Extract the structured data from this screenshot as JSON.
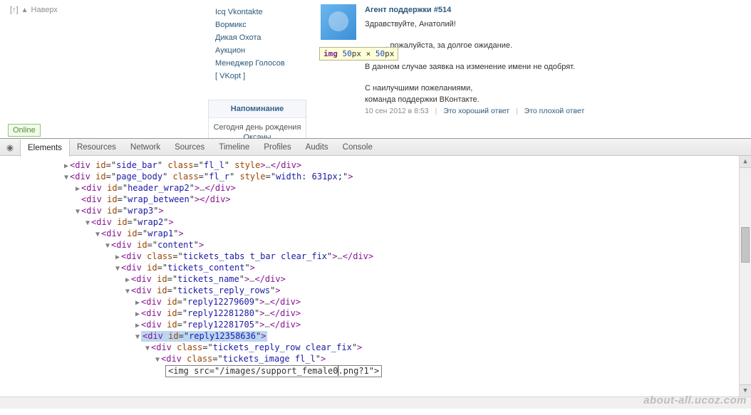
{
  "back_to_top": {
    "symbol": "[↑]",
    "label": "Наверх"
  },
  "sidebar": {
    "links": [
      "Icq Vkontakte",
      "Вормикс",
      "Дикая Охота",
      "Аукцион",
      "Менеджер Голосов"
    ],
    "vkopt": "[ VKopt ]"
  },
  "reminder": {
    "title": "Напоминание",
    "prefix": "Сегодня",
    "mid": " день рождения ",
    "name": "Оксаны"
  },
  "tooltip": {
    "kw": "img",
    "n1": "50",
    "px1": "px",
    "times": " × ",
    "n2": "50",
    "px2": "px"
  },
  "message": {
    "author": "Агент поддержки #514",
    "greeting": "Здравствуйте, Анатолий!",
    "p2_tail": ", пожалуйста, за долгое ожидание.",
    "p3": "В данном случае заявка на изменение имени не одобрят.",
    "p4a": "С наилучшими пожеланиями,",
    "p4b": "команда поддержки ВКонтакте.",
    "date": "10 сен 2012 в 8:53",
    "good": "Это хороший ответ",
    "bad": "Это плохой ответ"
  },
  "status": {
    "online": "Online"
  },
  "devtools": {
    "tabs": [
      "Elements",
      "Resources",
      "Network",
      "Sources",
      "Timeline",
      "Profiles",
      "Audits",
      "Console"
    ],
    "active_tab": 0,
    "tree": [
      {
        "indent": 88,
        "open": false,
        "html": "<div id=\"side_bar\" class=\"fl_l\" style>…</div>"
      },
      {
        "indent": 88,
        "open": true,
        "html": "<div id=\"page_body\" class=\"fl_r\" style=\"width: 631px;\">"
      },
      {
        "indent": 104,
        "open": false,
        "html": "<div id=\"header_wrap2\">…</div>"
      },
      {
        "indent": 104,
        "open": null,
        "html": "<div id=\"wrap_between\"></div>"
      },
      {
        "indent": 104,
        "open": true,
        "html": "<div id=\"wrap3\">"
      },
      {
        "indent": 118,
        "open": true,
        "html": "<div id=\"wrap2\">"
      },
      {
        "indent": 132,
        "open": true,
        "html": "<div id=\"wrap1\">"
      },
      {
        "indent": 146,
        "open": true,
        "html": "<div id=\"content\">"
      },
      {
        "indent": 160,
        "open": false,
        "html": "<div class=\"tickets_tabs t_bar clear_fix\">…</div>"
      },
      {
        "indent": 160,
        "open": true,
        "html": "<div id=\"tickets_content\">"
      },
      {
        "indent": 174,
        "open": false,
        "html": "<div id=\"tickets_name\">…</div>"
      },
      {
        "indent": 174,
        "open": true,
        "html": "<div id=\"tickets_reply_rows\">"
      },
      {
        "indent": 188,
        "open": false,
        "html": "<div id=\"reply12279609\">…</div>"
      },
      {
        "indent": 188,
        "open": false,
        "html": "<div id=\"reply12281280\">…</div>"
      },
      {
        "indent": 188,
        "open": false,
        "html": "<div id=\"reply12281705\">…</div>"
      },
      {
        "indent": 188,
        "open": true,
        "html": "<div id=\"reply12358636\">",
        "highlight": true
      },
      {
        "indent": 202,
        "open": true,
        "html": "<div class=\"tickets_reply_row clear_fix\">"
      },
      {
        "indent": 216,
        "open": true,
        "html": "<div class=\"tickets_image fl_l\">"
      }
    ],
    "editable": "<img src=\"/images/support_female0|.png?1\">"
  },
  "watermark": "about-all.ucoz.com"
}
